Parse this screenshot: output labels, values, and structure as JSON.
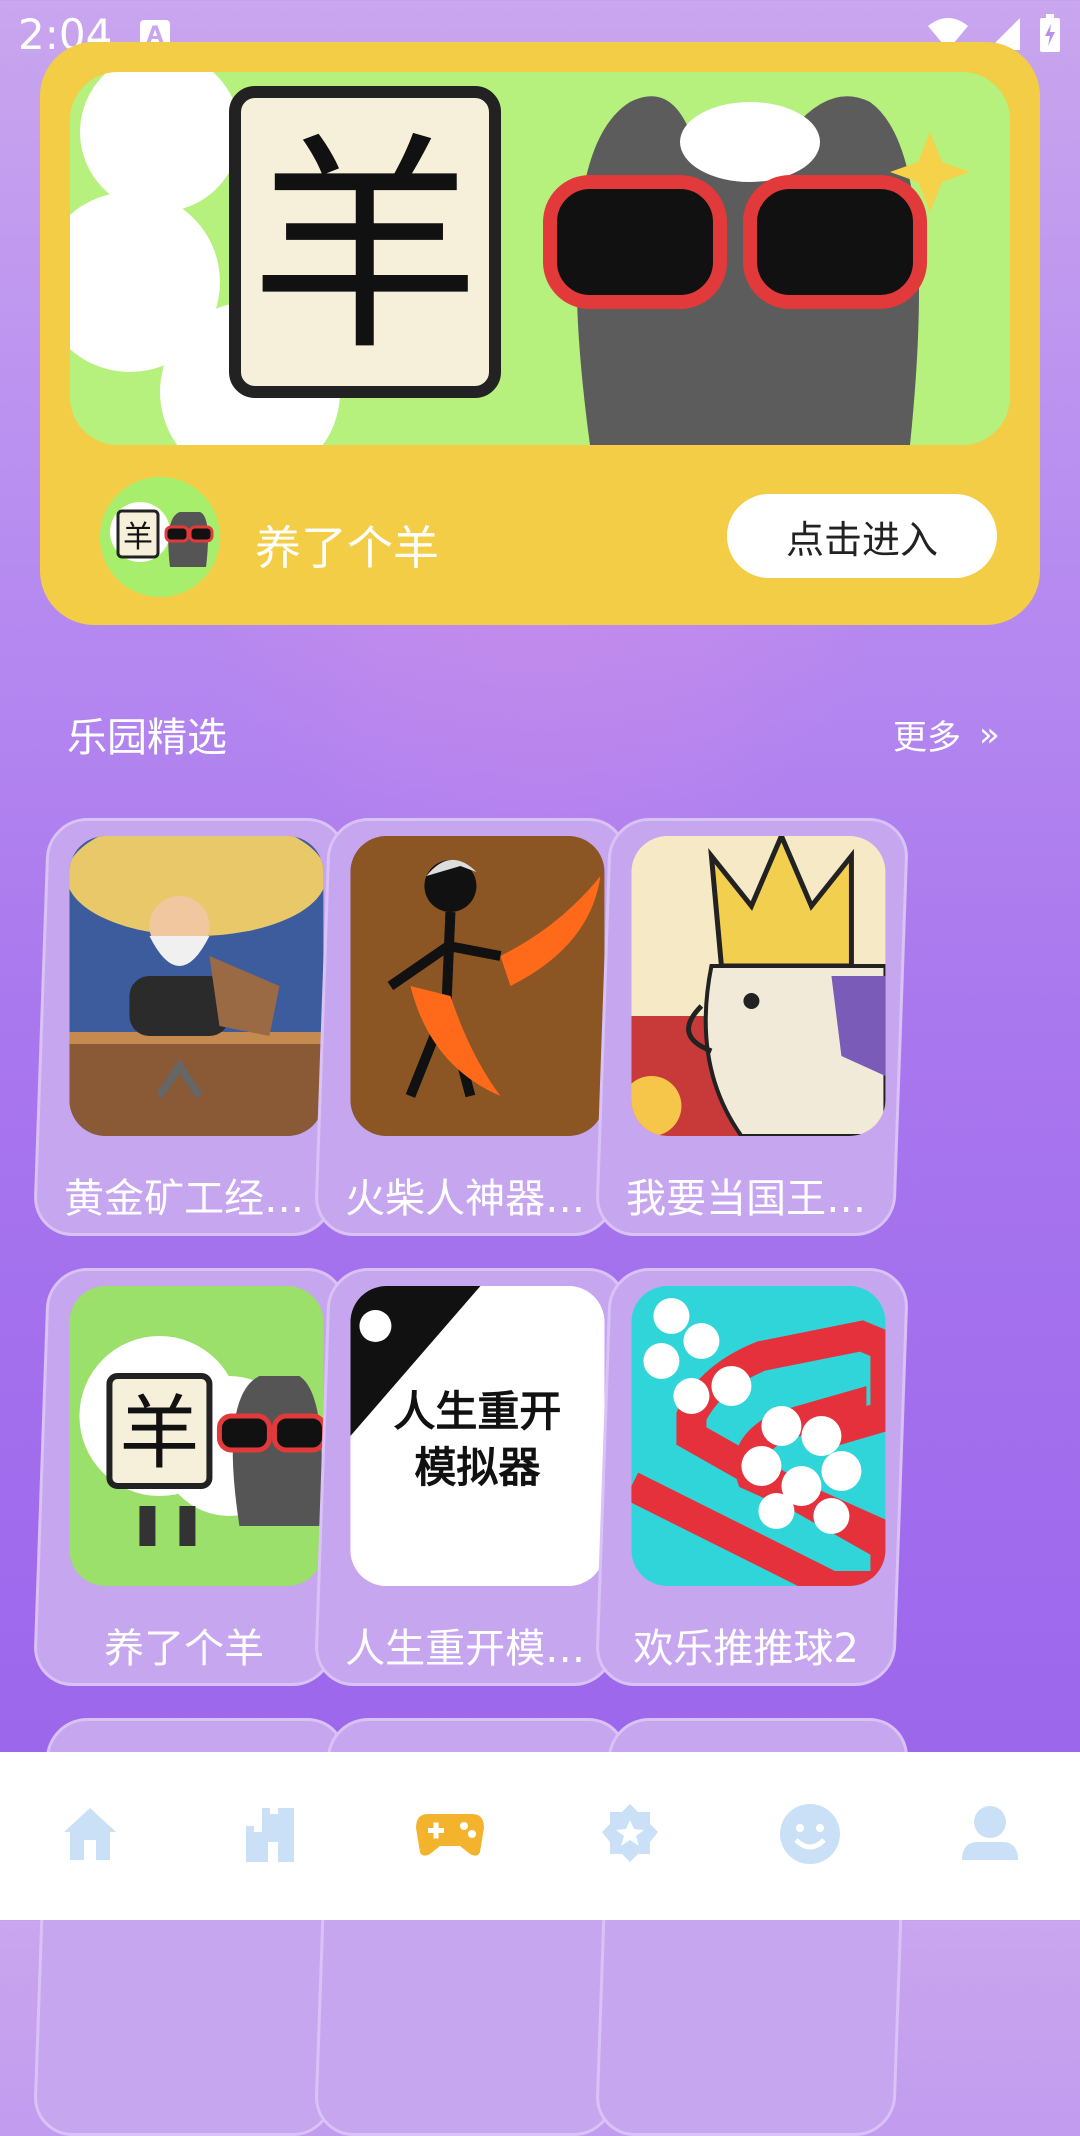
{
  "status_bar": {
    "time": "2:04",
    "notification_letter": "A"
  },
  "featured": {
    "banner_glyph": "羊",
    "title": "养了个羊",
    "enter_label": "点击进入"
  },
  "section": {
    "title": "乐园精选",
    "more_label": "更多",
    "more_icon": "»"
  },
  "games": [
    {
      "name": "黄金矿工经…",
      "thumb_color": "#3d5c9e"
    },
    {
      "name": "火柴人神器…",
      "thumb_color": "#7a4a1e"
    },
    {
      "name": "我要当国王…",
      "thumb_color": "#f6e9c6"
    },
    {
      "name": "养了个羊",
      "thumb_color": "#9be06a"
    },
    {
      "name": "人生重开模…",
      "thumb_color": "#ffffff",
      "thumb_text": "人生重开\n模拟器"
    },
    {
      "name": "欢乐推推球2",
      "thumb_color": "#2fd5d9"
    }
  ],
  "colors": {
    "card_yellow": "#f4cd46",
    "nav_inactive": "#c9e0f6",
    "nav_active": "#f4b32c"
  },
  "nav": [
    {
      "icon": "home-icon",
      "active": false
    },
    {
      "icon": "castle-icon",
      "active": false
    },
    {
      "icon": "gamepad-icon",
      "active": true
    },
    {
      "icon": "star-badge-icon",
      "active": false
    },
    {
      "icon": "smiley-icon",
      "active": false
    },
    {
      "icon": "person-icon",
      "active": false
    }
  ]
}
